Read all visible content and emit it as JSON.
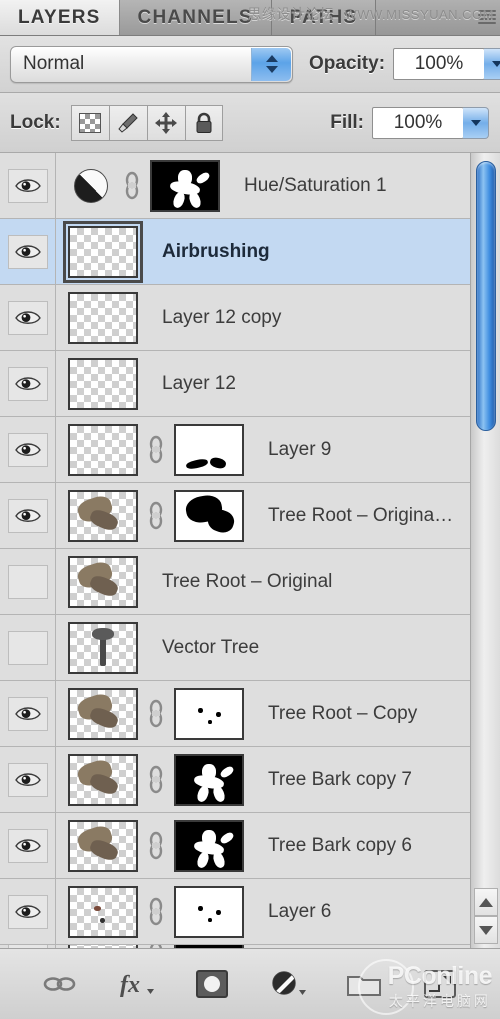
{
  "panel": {
    "tabs": [
      {
        "label": "LAYERS",
        "active": true
      },
      {
        "label": "CHANNELS",
        "active": false
      },
      {
        "label": "PATHS",
        "active": false
      }
    ],
    "menu_icon": "panel-menu-icon"
  },
  "blend": {
    "mode_value": "Normal",
    "opacity_label": "Opacity:",
    "opacity_value": "100%"
  },
  "lock": {
    "label": "Lock:",
    "buttons": [
      {
        "name": "lock-transparent-pixels",
        "icon": "checkerboard-icon"
      },
      {
        "name": "lock-image-pixels",
        "icon": "brush-icon"
      },
      {
        "name": "lock-position",
        "icon": "move-cross-icon"
      },
      {
        "name": "lock-all",
        "icon": "padlock-icon"
      }
    ],
    "fill_label": "Fill:",
    "fill_value": "100%"
  },
  "layers": [
    {
      "name": "Hue/Saturation 1",
      "visible": true,
      "selected": false,
      "thumb": "adjustment",
      "linked": true,
      "mask": "black"
    },
    {
      "name": "Airbrushing",
      "visible": true,
      "selected": true,
      "thumb": "transparent",
      "linked": false,
      "mask": "none"
    },
    {
      "name": "Layer 12 copy",
      "visible": true,
      "selected": false,
      "thumb": "transparent",
      "linked": false,
      "mask": "none"
    },
    {
      "name": "Layer 12",
      "visible": true,
      "selected": false,
      "thumb": "transparent",
      "linked": false,
      "mask": "none"
    },
    {
      "name": "Layer 9",
      "visible": true,
      "selected": false,
      "thumb": "transparent",
      "linked": true,
      "mask": "white"
    },
    {
      "name": "Tree Root – Origina…",
      "visible": true,
      "selected": false,
      "thumb": "bark",
      "linked": true,
      "mask": "whiteblob"
    },
    {
      "name": "Tree Root – Original",
      "visible": false,
      "selected": false,
      "thumb": "bark",
      "linked": false,
      "mask": "none"
    },
    {
      "name": "Vector Tree",
      "visible": false,
      "selected": false,
      "thumb": "tree",
      "linked": false,
      "mask": "none"
    },
    {
      "name": "Tree Root – Copy",
      "visible": true,
      "selected": false,
      "thumb": "bark",
      "linked": true,
      "mask": "whitedots"
    },
    {
      "name": "Tree Bark copy 7",
      "visible": true,
      "selected": false,
      "thumb": "bark",
      "linked": true,
      "mask": "black"
    },
    {
      "name": "Tree Bark copy 6",
      "visible": true,
      "selected": false,
      "thumb": "bark",
      "linked": true,
      "mask": "black"
    },
    {
      "name": "Layer 6",
      "visible": true,
      "selected": false,
      "thumb": "speck",
      "linked": true,
      "mask": "whitedots"
    }
  ],
  "scrollbar": {
    "up_arrow": "scroll-up-arrow",
    "down_arrow": "scroll-down-arrow"
  },
  "bottom_bar": [
    {
      "name": "link-layers-button",
      "icon": "link-icon"
    },
    {
      "name": "layer-style-button",
      "icon": "fx-icon"
    },
    {
      "name": "add-layer-mask-button",
      "icon": "mask-icon"
    },
    {
      "name": "new-adjustment-layer-button",
      "icon": "adjustment-circle-icon"
    },
    {
      "name": "new-group-button",
      "icon": "folder-icon"
    },
    {
      "name": "new-layer-button",
      "icon": "new-layer-icon"
    }
  ],
  "watermarks": {
    "top_cn": "思缘设计论坛",
    "top_url": "WWW.MISSYUAN.COM",
    "bottom_brand": "PConline",
    "bottom_cn": "太平洋电脑网"
  },
  "colors": {
    "selection": "#c3d9f2",
    "panel_bg": "#d9d9d9",
    "scroll_thumb": "#3f8de0"
  }
}
